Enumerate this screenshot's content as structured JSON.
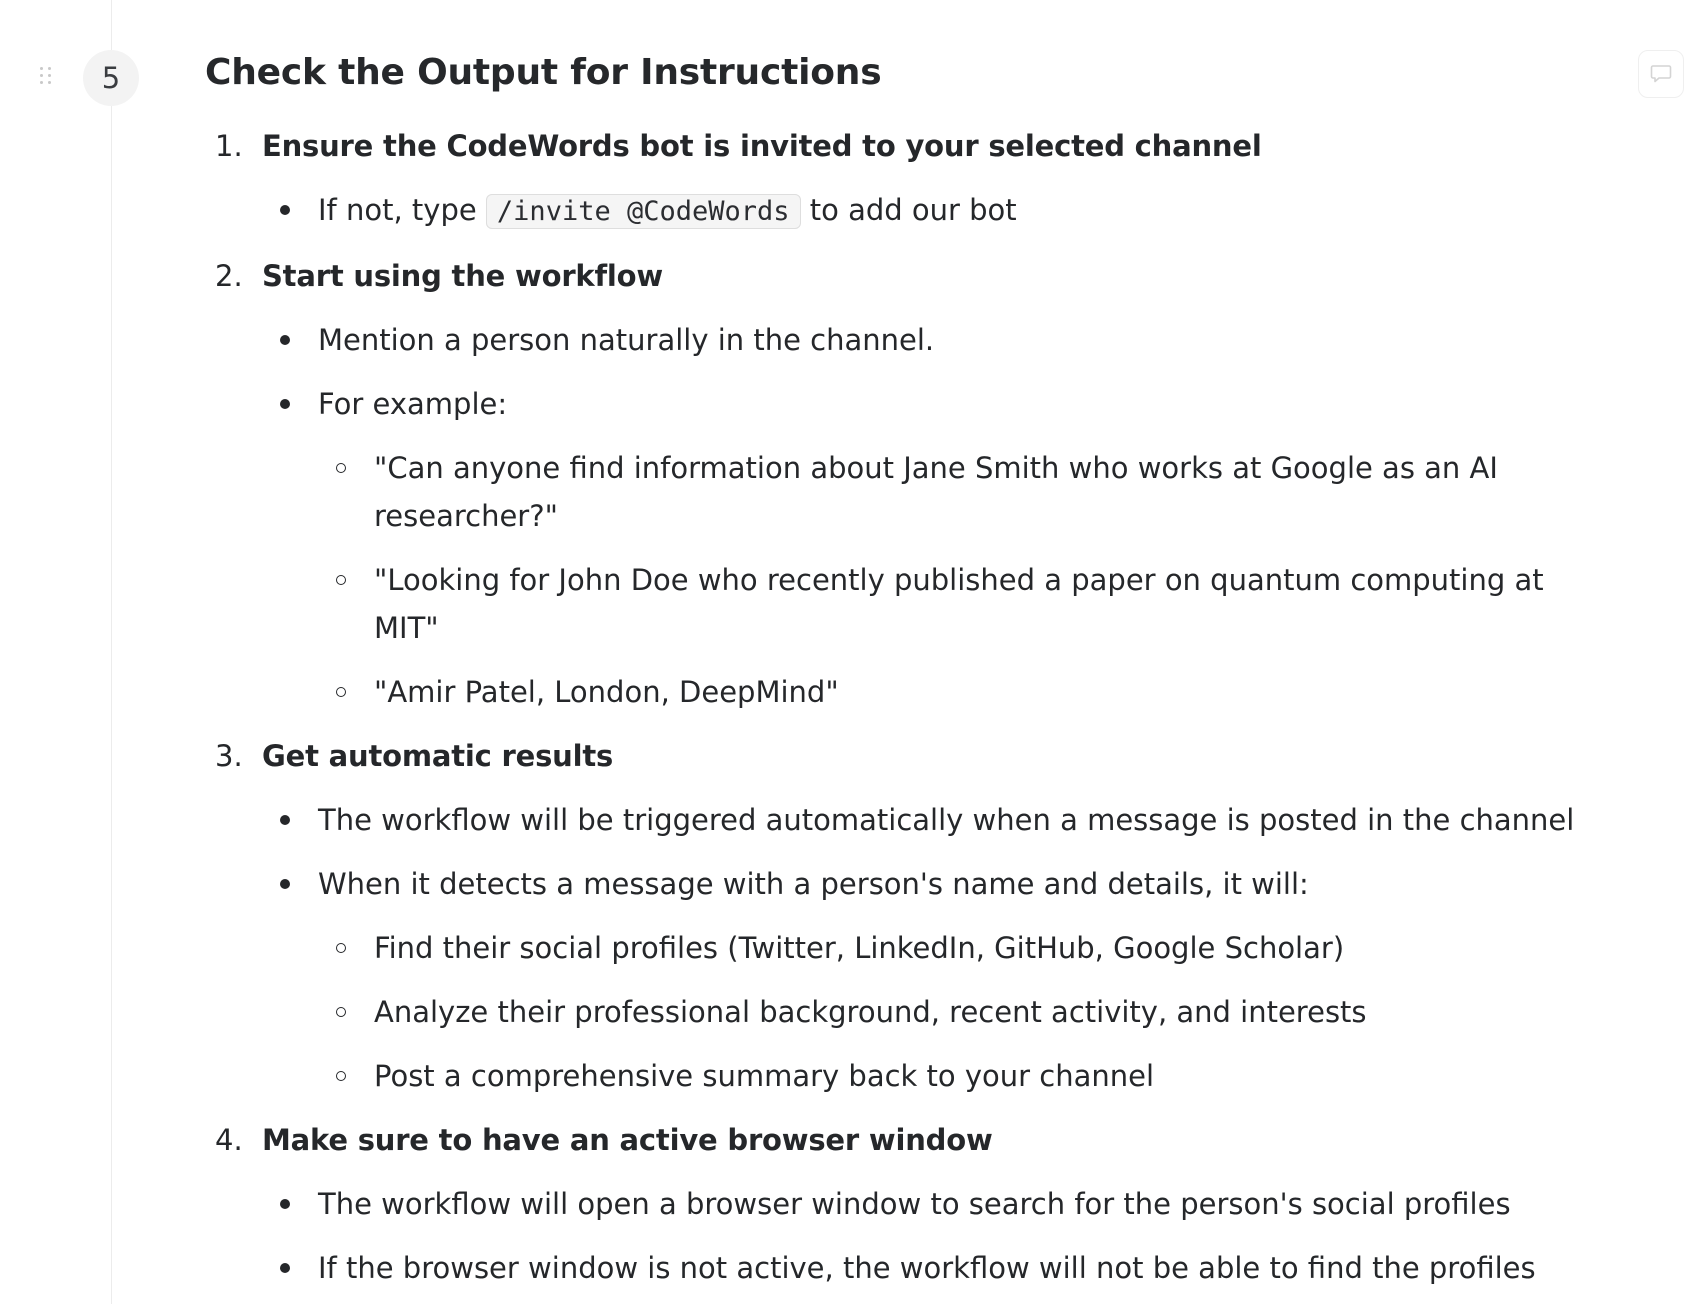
{
  "step": {
    "number": "5",
    "title": "Check the Output for Instructions"
  },
  "icons": {
    "drag_handle": "drag-handle-icon",
    "comment": "comment-icon"
  },
  "items": [
    {
      "number": "1.",
      "heading": "Ensure the CodeWords bot is invited to your selected channel",
      "bullets": [
        {
          "text_before": "If not, type ",
          "code": "/invite @CodeWords",
          "text_after": " to add our bot"
        }
      ]
    },
    {
      "number": "2.",
      "heading": "Start using the workflow",
      "bullets": [
        {
          "text": "Mention a person naturally in the channel."
        },
        {
          "text": "For example:",
          "sub": [
            "\"Can anyone find information about Jane Smith who works at Google as an AI researcher?\"",
            "\"Looking for John Doe who recently published a paper on quantum computing at MIT\"",
            "\"Amir Patel, London, DeepMind\""
          ]
        }
      ]
    },
    {
      "number": "3.",
      "heading": "Get automatic results",
      "bullets": [
        {
          "text": "The workflow will be triggered automatically when a message is posted in the channel"
        },
        {
          "text": "When it detects a message with a person's name and details, it will:",
          "sub": [
            "Find their social profiles (Twitter, LinkedIn, GitHub, Google Scholar)",
            "Analyze their professional background, recent activity, and interests",
            "Post a comprehensive summary back to your channel"
          ]
        }
      ]
    },
    {
      "number": "4.",
      "heading": "Make sure to have an active browser window",
      "bullets": [
        {
          "text": "The workflow will open a browser window to search for the person's social profiles"
        },
        {
          "text": "If the browser window is not active, the workflow will not be able to find the profiles"
        }
      ]
    }
  ]
}
